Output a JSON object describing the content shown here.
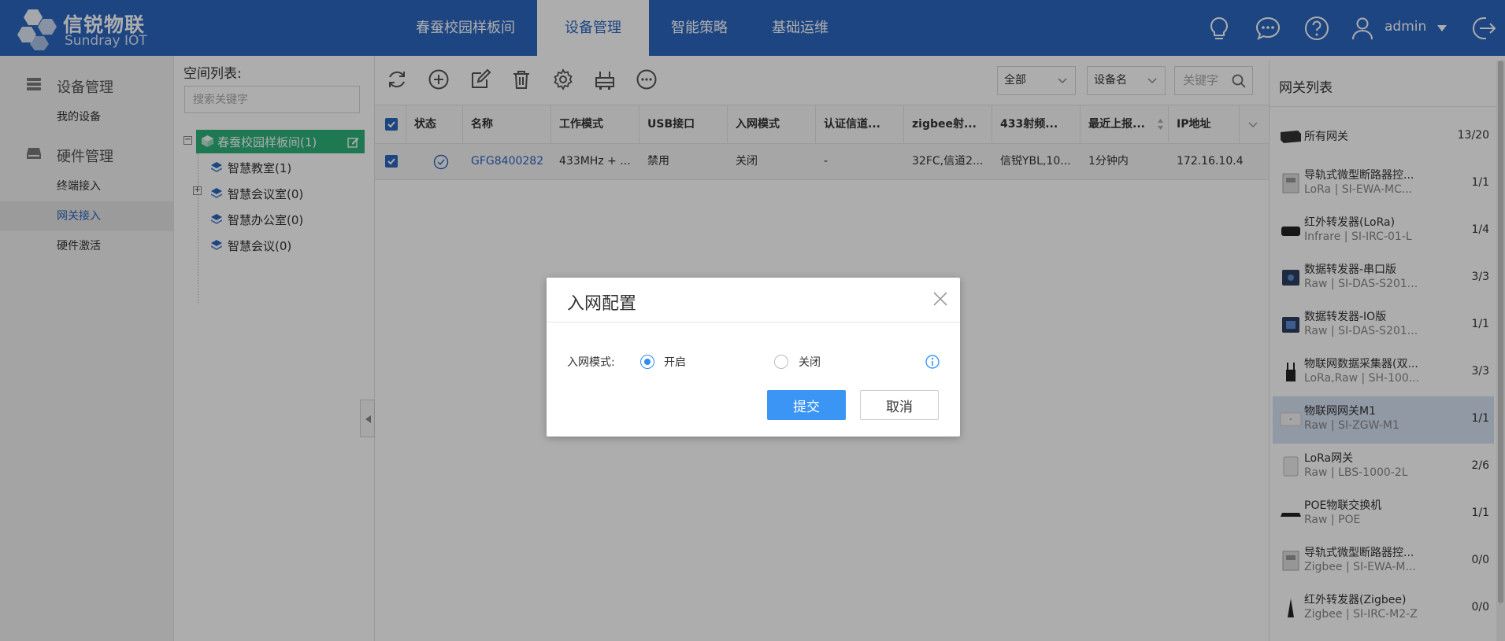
{
  "brand": {
    "name": "信锐物联",
    "sub": "Sundray IOT"
  },
  "nav": [
    "春蚕校园样板间",
    "设备管理",
    "智能策略",
    "基础运维"
  ],
  "user": {
    "name": "admin"
  },
  "sidebar": {
    "group1": "设备管理",
    "items1": [
      "我的设备"
    ],
    "group2": "硬件管理",
    "items2": [
      "终端接入",
      "网关接入",
      "硬件激活"
    ]
  },
  "space": {
    "title": "空间列表:",
    "search_placeholder": "搜索关键字",
    "root": "春蚕校园样板间(1)",
    "children": [
      "智慧教室(1)",
      "智慧会议室(0)",
      "智慧办公室(0)",
      "智慧会议(0)"
    ]
  },
  "filters": {
    "scope": "全部",
    "field": "设备名",
    "keyword_placeholder": "关键字"
  },
  "table": {
    "headers": [
      "状态",
      "名称",
      "工作模式",
      "USB接口",
      "入网模式",
      "认证信道...",
      "zigbee射...",
      "433射频...",
      "最近上报...",
      "IP地址"
    ],
    "row": [
      "GFG8400282",
      "433MHz + ...",
      "禁用",
      "关闭",
      "-",
      "32FC,信道2...",
      "信锐YBL,10...",
      "1分钟内",
      "172.16.10.4"
    ]
  },
  "gateways": {
    "title": "网关列表",
    "items": [
      {
        "name": "所有网关",
        "sub": "",
        "count": "13/20"
      },
      {
        "name": "导轨式微型断路器控...",
        "sub": "LoRa | SI-EWA-MC...",
        "count": "1/1"
      },
      {
        "name": "红外转发器(LoRa)",
        "sub": "Infrare | SI-IRC-01-L",
        "count": "1/4"
      },
      {
        "name": "数据转发器-串口版",
        "sub": "Raw | SI-DAS-S201...",
        "count": "3/3"
      },
      {
        "name": "数据转发器-IO版",
        "sub": "Raw | SI-DAS-S201...",
        "count": "1/1"
      },
      {
        "name": "物联网数据采集器(双...",
        "sub": "LoRa,Raw | SH-100...",
        "count": "3/3"
      },
      {
        "name": "物联网网关M1",
        "sub": "Raw | SI-ZGW-M1",
        "count": "1/1"
      },
      {
        "name": "LoRa网关",
        "sub": "Raw | LBS-1000-2L",
        "count": "2/6"
      },
      {
        "name": "POE物联交换机",
        "sub": "Raw | POE",
        "count": "1/1"
      },
      {
        "name": "导轨式微型断路器控...",
        "sub": "Zigbee | SI-EWA-M...",
        "count": "0/0"
      },
      {
        "name": "红外转发器(Zigbee)",
        "sub": "Zigbee | SI-IRC-M2-Z",
        "count": "0/0"
      }
    ]
  },
  "modal": {
    "title": "入网配置",
    "label": "入网模式:",
    "option_on": "开启",
    "option_off": "关闭",
    "selected": "开启",
    "submit": "提交",
    "cancel": "取消"
  },
  "colors": {
    "primary": "#2c66c0",
    "accent": "#3a95f5",
    "tree_active": "#2db27a"
  }
}
